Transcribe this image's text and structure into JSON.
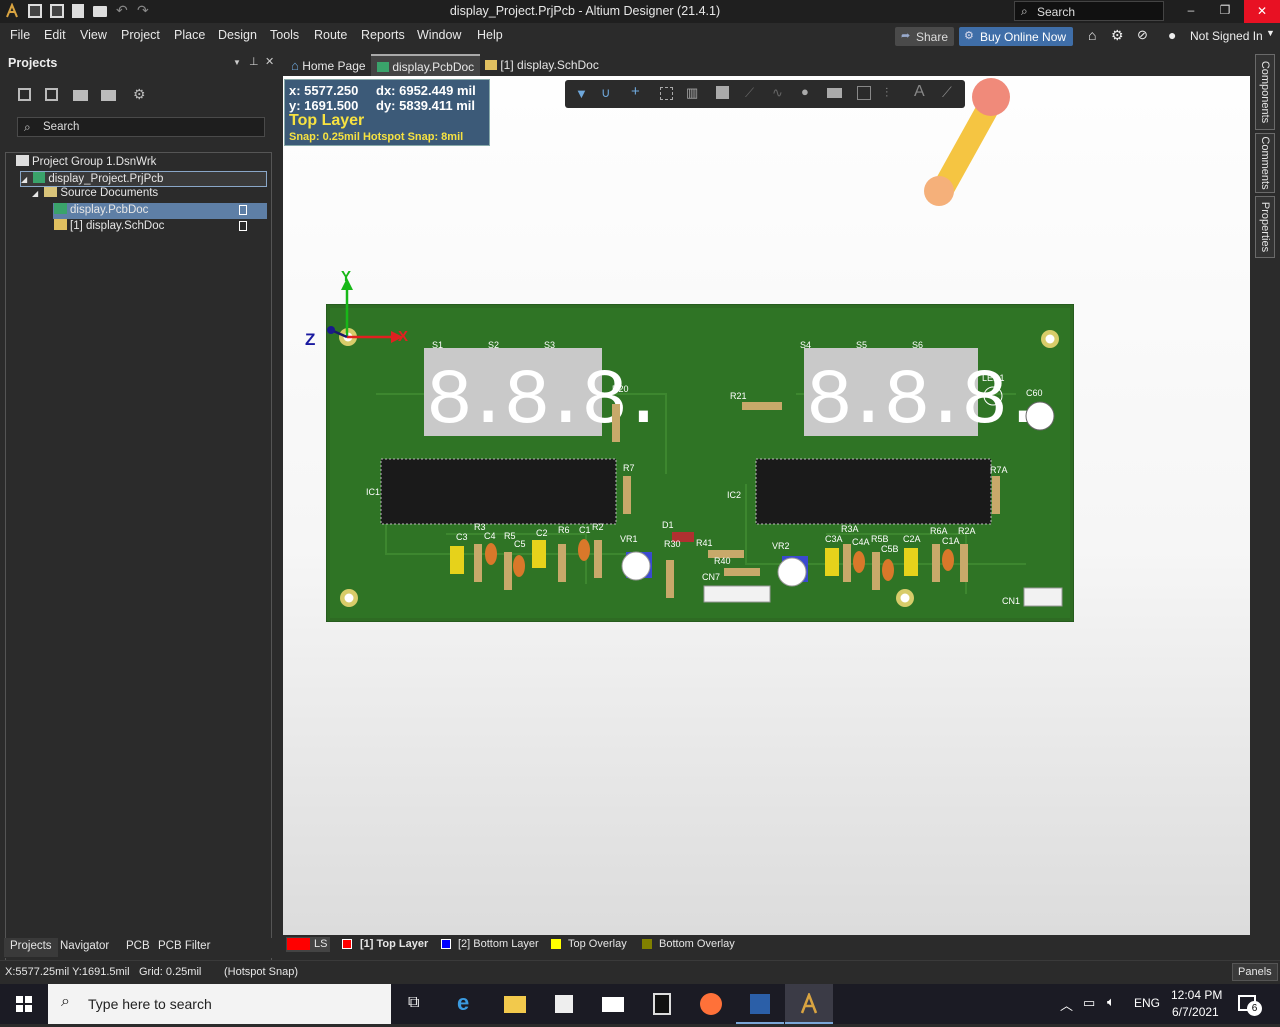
{
  "window": {
    "title": "display_Project.PrjPcb - Altium Designer (21.4.1)",
    "search_placeholder": "Search",
    "controls": {
      "minimize": "–",
      "restore": "❐",
      "close": "✕"
    }
  },
  "menu": [
    "File",
    "Edit",
    "View",
    "Project",
    "Place",
    "Design",
    "Tools",
    "Route",
    "Reports",
    "Window",
    "Help"
  ],
  "topright": {
    "share": "Share",
    "buy": "Buy Online Now",
    "signin": "Not Signed In"
  },
  "projects_panel": {
    "title": "Projects",
    "search_placeholder": "Search",
    "tree": {
      "group": "Project Group 1.DsnWrk",
      "project": "display_Project.PrjPcb",
      "folder": "Source Documents",
      "doc1": "display.PcbDoc",
      "doc2": "[1] display.SchDoc"
    },
    "bottom_tabs": [
      "Projects",
      "Navigator",
      "PCB",
      "PCB Filter"
    ]
  },
  "doc_tabs": [
    "Home Page",
    "display.PcbDoc",
    "[1] display.SchDoc"
  ],
  "hud": {
    "x": "x: 5577.250",
    "dx": "dx: 6952.449 mil",
    "y": "y: 1691.500",
    "dy": "dy: 5839.411 mil",
    "layer": "Top Layer",
    "snap": "Snap: 0.25mil Hotspot Snap: 8mil"
  },
  "axes": {
    "y": "Y",
    "x": "X",
    "z": "Z"
  },
  "pcb": {
    "digits_left": "8.8.8.",
    "digits_right": "8.8.8.",
    "silk_labels": {
      "S1": "S1",
      "S2": "S2",
      "S3": "S3",
      "S4": "S4",
      "S5": "S5",
      "S6": "S6",
      "R20": "R20",
      "R21": "R21",
      "LED1": "LED1",
      "C60": "C60",
      "R7": "R7",
      "R7A": "R7A",
      "IC1": "IC1",
      "IC2": "IC2",
      "D1": "D1",
      "VR1": "VR1",
      "VR2": "VR2",
      "R30": "R30",
      "R41": "R41",
      "R40": "R40",
      "CN7": "CN7",
      "CN1": "CN1",
      "C3": "C3",
      "C4": "C4",
      "R5": "R5",
      "C5": "C5",
      "C2": "C2",
      "R6": "R6",
      "C1": "C1",
      "R2": "R2",
      "C3A": "C3A",
      "C4A": "C4A",
      "R3A": "R3A",
      "R5B": "R5B",
      "C5B": "C5B",
      "C2A": "C2A",
      "R6A": "R6A",
      "R2A": "R2A",
      "C1A": "C1A",
      "R3": "R3"
    }
  },
  "right_tabs": [
    "Components",
    "Comments",
    "Properties"
  ],
  "layers": [
    {
      "label": "LS",
      "color": "#ff0000"
    },
    {
      "label": "[1] Top Layer",
      "color": "#ff0000"
    },
    {
      "label": "[2] Bottom Layer",
      "color": "#0000ff"
    },
    {
      "label": "Top Overlay",
      "color": "#ffff00"
    },
    {
      "label": "Bottom Overlay",
      "color": "#808000"
    }
  ],
  "status": {
    "coords": "X:5577.25mil Y:1691.5mil",
    "grid": "Grid: 0.25mil",
    "snap": "(Hotspot Snap)",
    "panels": "Panels"
  },
  "taskbar": {
    "search_placeholder": "Type here to search",
    "lang": "ENG",
    "time": "12:04 PM",
    "date": "6/7/2021",
    "notifications": "6"
  }
}
